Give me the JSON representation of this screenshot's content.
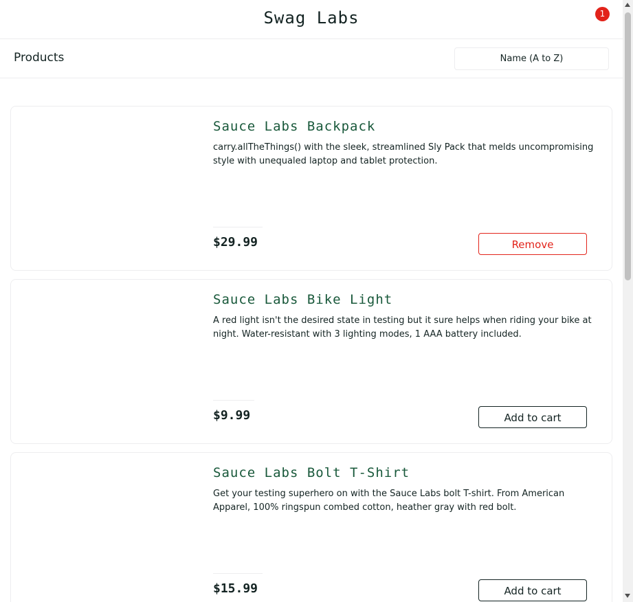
{
  "header": {
    "app_title": "Swag Labs",
    "cart_count": "1",
    "badge_color": "#e2231a"
  },
  "subheader": {
    "title": "Products",
    "sort_value": "Name (A to Z)"
  },
  "colors": {
    "item_name": "#18583a",
    "remove": "#e2231a",
    "text": "#132322"
  },
  "items": [
    {
      "name": "Sauce Labs Backpack",
      "desc": "carry.allTheThings() with the sleek, streamlined Sly Pack that melds uncompromising style with unequaled laptop and tablet protection.",
      "price": "$29.99",
      "button": "Remove"
    },
    {
      "name": "Sauce Labs Bike Light",
      "desc": "A red light isn't the desired state in testing but it sure helps when riding your bike at night. Water-resistant with 3 lighting modes, 1 AAA battery included.",
      "price": "$9.99",
      "button": "Add to cart"
    },
    {
      "name": "Sauce Labs Bolt T-Shirt",
      "desc": "Get your testing superhero on with the Sauce Labs bolt T-shirt. From American Apparel, 100% ringspun combed cotton, heather gray with red bolt.",
      "price": "$15.99",
      "button": "Add to cart"
    }
  ]
}
